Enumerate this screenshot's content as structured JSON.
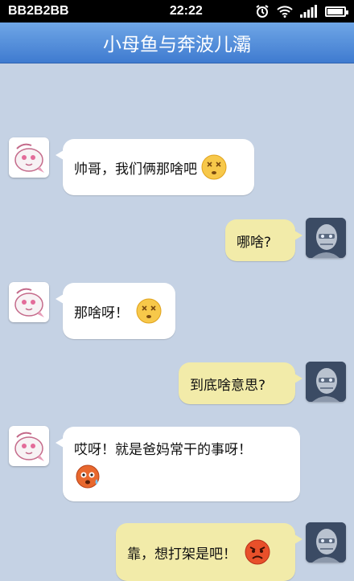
{
  "status_bar": {
    "carrier": "BB2B2BB",
    "time": "22:22"
  },
  "header": {
    "title": "小母鱼与奔波儿灞"
  },
  "messages": [
    {
      "side": "left",
      "text": "帅哥，我们俩那啥吧",
      "emoji": "dizzy-face-icon"
    },
    {
      "side": "right",
      "text": "哪啥?"
    },
    {
      "side": "left",
      "text": "那啥呀！",
      "emoji": "dizzy-face-icon"
    },
    {
      "side": "right",
      "text": "到底啥意思?"
    },
    {
      "side": "left",
      "text": "哎呀！就是爸妈常干的事呀！",
      "emoji": "sweating-face-icon"
    },
    {
      "side": "right",
      "text": "靠，想打架是吧！",
      "emoji": "angry-face-icon"
    }
  ],
  "colors": {
    "chat_background": "#c5d2e4",
    "header": "#4f8ad8",
    "incoming_bubble": "#ffffff",
    "outgoing_bubble": "#f2eba9"
  }
}
